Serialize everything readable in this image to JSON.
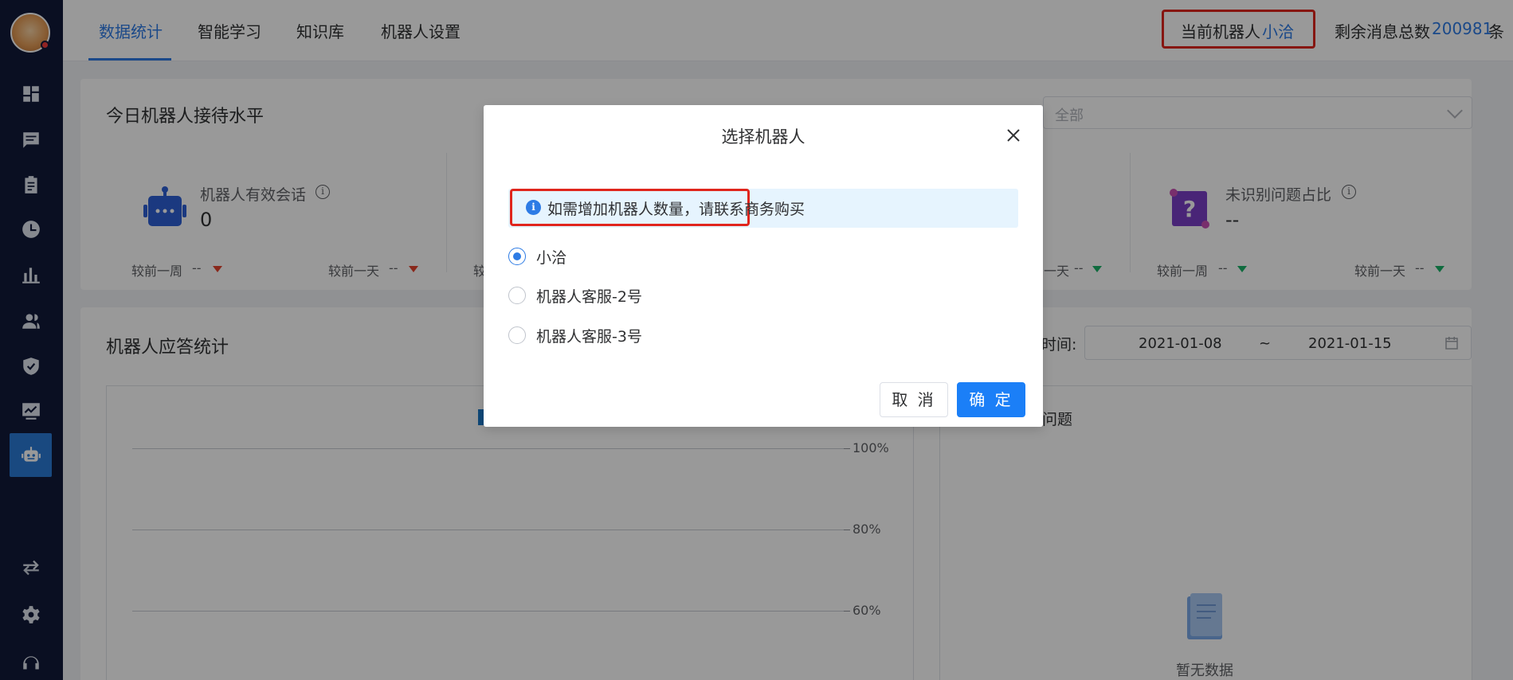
{
  "nav": {
    "tabs": [
      "数据统计",
      "智能学习",
      "知识库",
      "机器人设置"
    ],
    "current_robot_label": "当前机器人",
    "current_robot_value": "小洽",
    "remaining_label": "剩余消息总数",
    "remaining_value": "200981",
    "remaining_unit": "条"
  },
  "sidebar": {
    "icons": [
      "dashboard-icon",
      "message-icon",
      "clipboard-icon",
      "clock-icon",
      "bar-chart-icon",
      "users-icon",
      "shield-icon",
      "monitor-chart-icon",
      "robot-icon",
      "swap-icon",
      "settings-icon",
      "headset-icon"
    ],
    "active": "robot-icon"
  },
  "card1": {
    "title": "今日机器人接待水平",
    "filter_placeholder": "全部",
    "stats": [
      {
        "label": "机器人有效会话",
        "value": "0",
        "week_label": "较前一周",
        "week_value": "--",
        "day_label": "较前一天",
        "day_value": "--"
      },
      {
        "label": "未识别问题占比",
        "value": "--",
        "week_label": "较前一周",
        "week_value": "--",
        "day_label": "较前一天",
        "day_value": "--"
      }
    ],
    "partial_left": "较",
    "partial_right_day": "一天",
    "partial_right_value": "--"
  },
  "card2": {
    "title": "机器人应答统计",
    "date_label": "时间:",
    "date_start": "2021-01-08",
    "date_sep": "~",
    "date_end": "2021-01-15",
    "chart_ticks": [
      "100%",
      "80%",
      "60%"
    ],
    "right_title": "问题",
    "empty_text": "暂无数据"
  },
  "dialog": {
    "title": "选择机器人",
    "notice": "如需增加机器人数量，请联系商务购买",
    "options": [
      "小洽",
      "机器人客服-2号",
      "机器人客服-3号"
    ],
    "selected_index": 0,
    "cancel_label": "取 消",
    "ok_label": "确 定"
  },
  "colors": {
    "primary": "#2d7be5",
    "sidebar_bg": "#111a3a",
    "highlight_red": "#e0261d",
    "down_red": "#e5442d",
    "down_green": "#19b368"
  }
}
